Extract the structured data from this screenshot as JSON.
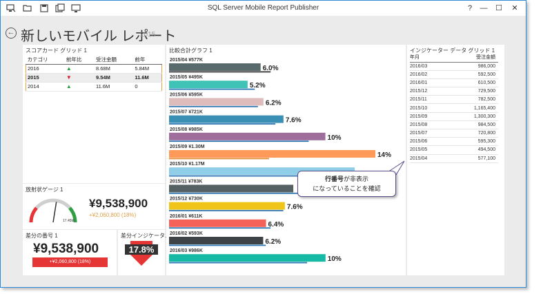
{
  "window": {
    "title": "SQL Server Mobile Report Publisher"
  },
  "header": {
    "title": "新しいモバイル レポート",
    "year": "2015"
  },
  "toolbar_icons": [
    "monitor-icon",
    "folder-icon",
    "save-icon",
    "save-as-icon",
    "publish-icon"
  ],
  "window_controls": {
    "help": "?",
    "minimize": "—",
    "maximize": "☐",
    "close": "✕"
  },
  "scorecard": {
    "title": "スコアカード グリッド 1",
    "headers": [
      "カテゴリ",
      "前年比",
      "受注金額",
      "前年"
    ],
    "rows": [
      {
        "category": "2016",
        "trend": "▲",
        "amount": "8.68M",
        "prev": "5.84M"
      },
      {
        "category": "2015",
        "trend": "▼",
        "amount": "9.54M",
        "prev": "11.6M"
      },
      {
        "category": "2014",
        "trend": "▲",
        "amount": "11.6M",
        "prev": "0"
      }
    ]
  },
  "gauge": {
    "title": "放射状ゲージ 1",
    "value": "¥9,538,900",
    "delta": "+¥2,060,800 (18%)",
    "max": "17.45M",
    "fraction": 0.55
  },
  "number": {
    "title": "差分の番号 1",
    "value": "¥9,538,900",
    "delta": "+¥2,060,800 (18%)"
  },
  "indicator": {
    "title": "差分インジケータ...",
    "value": "17.8%"
  },
  "chart_data": {
    "type": "bar",
    "title": "比較合計グラフ 1",
    "categories": [
      "2015/04",
      "2015/05",
      "2015/06",
      "2015/07",
      "2015/08",
      "2015/09",
      "2015/10",
      "2015/11",
      "2015/12",
      "2016/01",
      "2016/02",
      "2016/03"
    ],
    "amount_labels": [
      "¥577K",
      "¥495K",
      "¥595K",
      "¥721K",
      "¥985K",
      "¥1.30M",
      "¥1.17M",
      "¥783K",
      "¥730K",
      "¥611K",
      "¥593K",
      "¥986K"
    ],
    "values": [
      577,
      495,
      595,
      721,
      985,
      1300,
      1170,
      783,
      730,
      611,
      593,
      986
    ],
    "comparison": [
      640,
      540,
      560,
      670,
      880,
      630,
      1000,
      830,
      720,
      640,
      610,
      870
    ],
    "percent_labels": [
      "6.0%",
      "5.2%",
      "6.2%",
      "7.6%",
      "10%",
      "14%",
      "",
      "",
      "7.6%",
      "6.4%",
      "6.2%",
      "10%"
    ],
    "colors": [
      "#596a6d",
      "#3ec3b6",
      "#dfbcbc",
      "#3a8fb5",
      "#9e6d9c",
      "#ff9a5a",
      "#8fcde8",
      "#556063",
      "#f0c419",
      "#f4625a",
      "#3d4347",
      "#16b9a4"
    ],
    "comparison_color": "#2f77b5",
    "xlim": [
      0,
      1400
    ]
  },
  "grid": {
    "title": "インジケーター データ グリッド 1",
    "headers": [
      "年月",
      "受注金額"
    ],
    "rows": [
      [
        "2016/03",
        "986,000"
      ],
      [
        "2016/02",
        "592,500"
      ],
      [
        "2016/01",
        "610,500"
      ],
      [
        "2015/12",
        "729,500"
      ],
      [
        "2015/11",
        "782,500"
      ],
      [
        "2015/10",
        "1,165,400"
      ],
      [
        "2015/09",
        "1,300,300"
      ],
      [
        "2015/08",
        "984,500"
      ],
      [
        "2015/07",
        "720,800"
      ],
      [
        "2015/06",
        "595,300"
      ],
      [
        "2015/05",
        "494,500"
      ],
      [
        "2015/04",
        "577,100"
      ]
    ]
  },
  "callout": {
    "line1_bold": "行番号",
    "line1_rest": "が非表示",
    "line2": "になっていることを確認"
  }
}
